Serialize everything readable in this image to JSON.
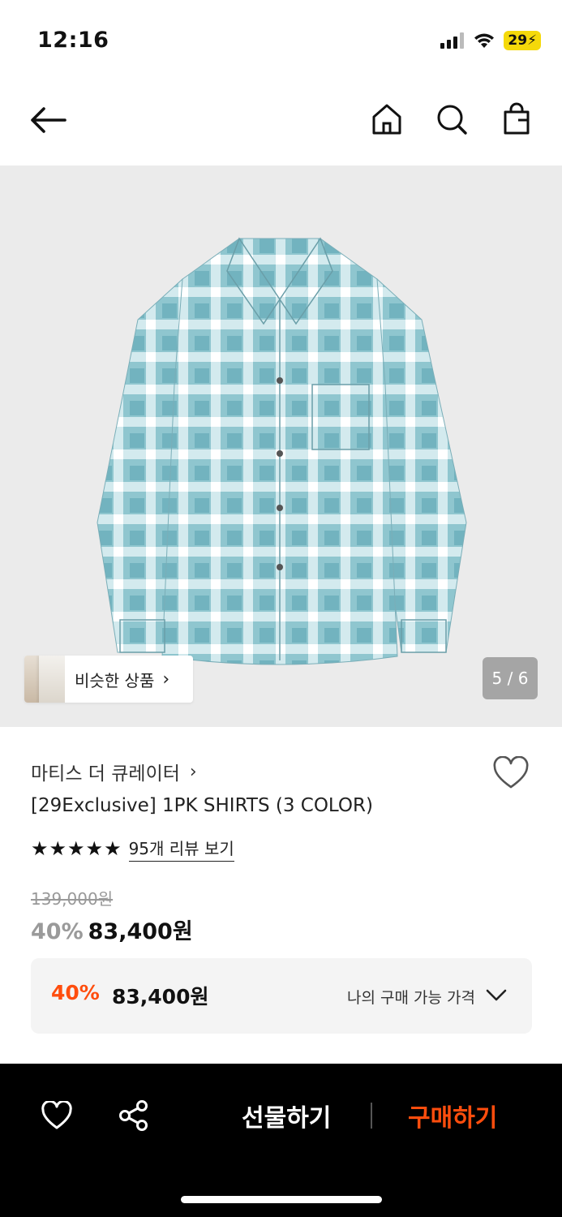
{
  "status_bar": {
    "time": "12:16",
    "battery": "29",
    "icons": [
      "signal-icon",
      "wifi-icon",
      "battery-charging-icon"
    ]
  },
  "nav": {
    "icons": [
      "back-arrow-icon",
      "home-icon",
      "search-icon",
      "shopping-bag-icon"
    ]
  },
  "gallery": {
    "similar_label": "비슷한 상품",
    "counter": "5 / 6"
  },
  "product": {
    "brand": "마티스 더 큐레이터",
    "name": "[29Exclusive] 1PK SHIRTS (3 COLOR)",
    "rating": 5,
    "review_link": "95개 리뷰 보기",
    "original_price": "139,000원",
    "discount": "40%",
    "price": "83,400원"
  },
  "my_price": {
    "discount": "40%",
    "price": "83,400원",
    "label": "나의 구매 가능 가격"
  },
  "bottom_bar": {
    "gift_label": "선물하기",
    "buy_label": "구매하기"
  },
  "colors": {
    "accent": "#ff4d0d",
    "shirt": "#7fb8c4"
  }
}
